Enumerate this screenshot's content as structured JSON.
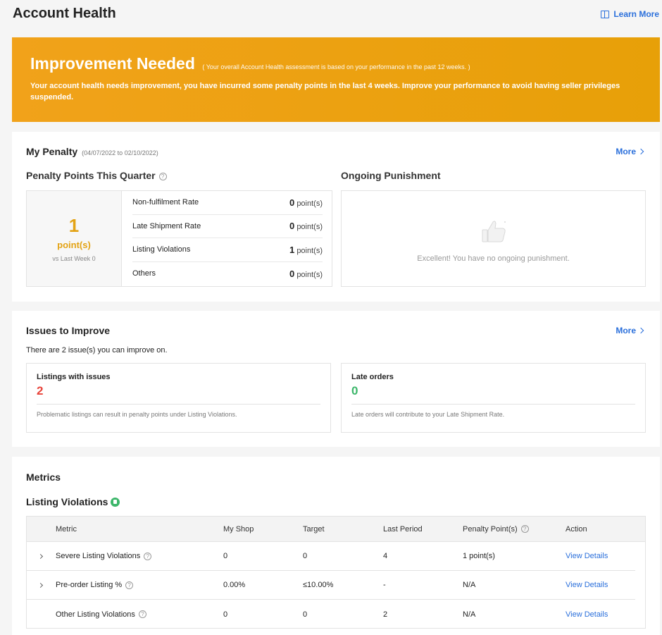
{
  "header": {
    "title": "Account Health",
    "learn_more": "Learn More"
  },
  "banner": {
    "title": "Improvement Needed",
    "note": "( Your overall Account Health assessment is based on your performance in the past 12 weeks. )",
    "description": "Your account health needs improvement, you have incurred some penalty points in the last 4 weeks. Improve your performance to avoid having seller privileges suspended."
  },
  "penalty": {
    "title": "My Penalty",
    "date_range": "(04/07/2022 to 02/10/2022)",
    "more": "More",
    "points_heading": "Penalty Points This Quarter",
    "total": "1",
    "total_unit": "point(s)",
    "vs_last_week": "vs Last Week 0",
    "rows": [
      {
        "label": "Non-fulfilment Rate",
        "value": "0",
        "unit": "point(s)"
      },
      {
        "label": "Late Shipment Rate",
        "value": "0",
        "unit": "point(s)"
      },
      {
        "label": "Listing Violations",
        "value": "1",
        "unit": "point(s)"
      },
      {
        "label": "Others",
        "value": "0",
        "unit": "point(s)"
      }
    ],
    "punishment_heading": "Ongoing Punishment",
    "punishment_text": "Excellent! You have no ongoing punishment."
  },
  "issues": {
    "title": "Issues to Improve",
    "more": "More",
    "subtitle": "There are 2 issue(s) you can improve on.",
    "cards": [
      {
        "name": "Listings with issues",
        "count": "2",
        "note": "Problematic listings can result in penalty points under Listing Violations.",
        "color": "#e8453c"
      },
      {
        "name": "Late orders",
        "count": "0",
        "note": "Late orders will contribute to your Late Shipment Rate.",
        "color": "#3cb66a"
      }
    ]
  },
  "metrics": {
    "title": "Metrics",
    "section": "Listing Violations",
    "columns": [
      "Metric",
      "My Shop",
      "Target",
      "Last Period",
      "Penalty Point(s)",
      "Action"
    ],
    "rows": [
      {
        "metric": "Severe Listing Violations",
        "shop": "0",
        "target": "0",
        "last": "4",
        "penalty": "1 point(s)",
        "action": "View Details"
      },
      {
        "metric": "Pre-order Listing %",
        "shop": "0.00%",
        "target": "≤10.00%",
        "last": "-",
        "penalty": "N/A",
        "action": "View Details"
      },
      {
        "metric": "Other Listing Violations",
        "shop": "0",
        "target": "0",
        "last": "2",
        "penalty": "N/A",
        "action": "View Details"
      }
    ]
  },
  "icons": {
    "learn_more": "book-icon",
    "help": "help-icon",
    "chevron": "chevron-right-icon",
    "thumb": "thumbs-up-icon",
    "badge": "thumbs-up-badge-icon"
  },
  "colors": {
    "banner": "#eda012",
    "accent_link": "#2a6fdb",
    "points": "#e3a315",
    "bad": "#e8453c",
    "good": "#3cb66a"
  }
}
